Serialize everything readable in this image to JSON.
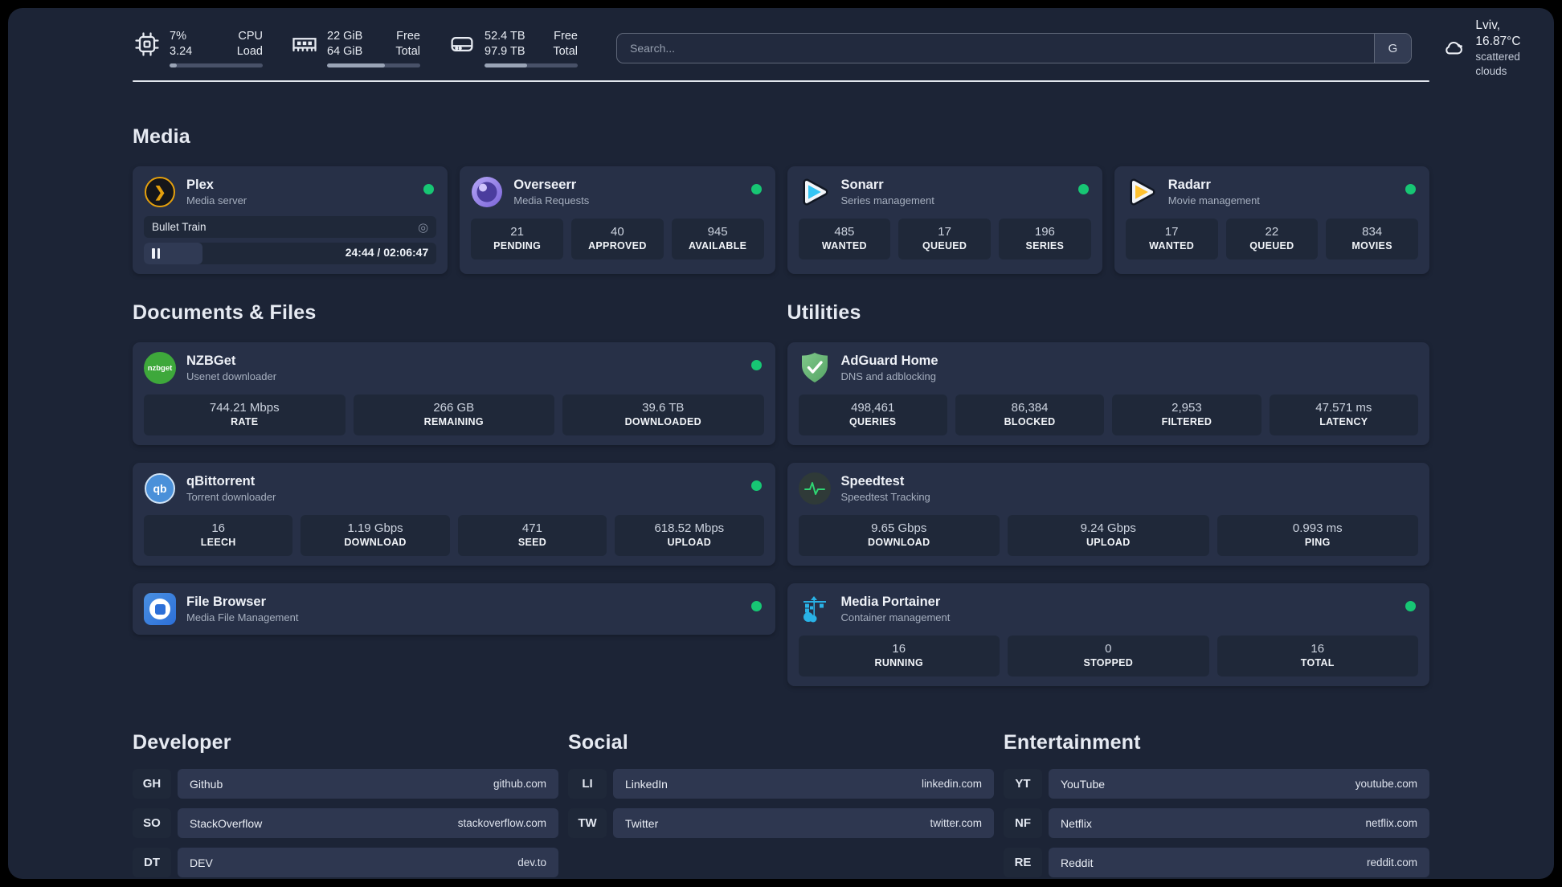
{
  "theme": {
    "panel_bg": "#1c2436",
    "card_bg": "#273047",
    "stat_bg": "#1f2839",
    "online_green": "#17c674",
    "plex_amber": "#e5a00d",
    "sonarr_blue": "#35c5f4",
    "radarr_amber": "#ffc230",
    "adguard_green": "#68bc71",
    "portainer_blue": "#29b2e6",
    "nzbget_green": "#3ea83b",
    "speedtest_green": "#2fd573"
  },
  "header": {
    "system_stats": [
      {
        "icon": "cpu-icon",
        "values": [
          "7%",
          "3.24"
        ],
        "labels": [
          "CPU",
          "Load"
        ],
        "progress": 8
      },
      {
        "icon": "ram-icon",
        "values": [
          "22 GiB",
          "64 GiB"
        ],
        "labels": [
          "Free",
          "Total"
        ],
        "progress": 62
      },
      {
        "icon": "disk-icon",
        "values": [
          "52.4 TB",
          "97.9 TB"
        ],
        "labels": [
          "Free",
          "Total"
        ],
        "progress": 46
      }
    ],
    "search": {
      "placeholder": "Search...",
      "engine_button": "G"
    },
    "weather": {
      "summary": "Lviv, 16.87°C",
      "condition": "scattered clouds"
    }
  },
  "media": {
    "title": "Media",
    "plex": {
      "name": "Plex",
      "desc": "Media server",
      "now_playing": "Bullet Train",
      "time": "24:44 / 02:06:47",
      "progress": 20
    },
    "overseerr": {
      "name": "Overseerr",
      "desc": "Media Requests",
      "stats": [
        {
          "value": "21",
          "label": "PENDING"
        },
        {
          "value": "40",
          "label": "APPROVED"
        },
        {
          "value": "945",
          "label": "AVAILABLE"
        }
      ]
    },
    "sonarr": {
      "name": "Sonarr",
      "desc": "Series management",
      "stats": [
        {
          "value": "485",
          "label": "WANTED"
        },
        {
          "value": "17",
          "label": "QUEUED"
        },
        {
          "value": "196",
          "label": "SERIES"
        }
      ]
    },
    "radarr": {
      "name": "Radarr",
      "desc": "Movie management",
      "stats": [
        {
          "value": "17",
          "label": "WANTED"
        },
        {
          "value": "22",
          "label": "QUEUED"
        },
        {
          "value": "834",
          "label": "MOVIES"
        }
      ]
    }
  },
  "documents": {
    "title": "Documents & Files",
    "nzbget": {
      "name": "NZBGet",
      "desc": "Usenet downloader",
      "icon_text": "nzbget",
      "stats": [
        {
          "value": "744.21 Mbps",
          "label": "RATE"
        },
        {
          "value": "266 GB",
          "label": "REMAINING"
        },
        {
          "value": "39.6 TB",
          "label": "DOWNLOADED"
        }
      ]
    },
    "qbittorrent": {
      "name": "qBittorrent",
      "desc": "Torrent downloader",
      "icon_text": "qb",
      "stats": [
        {
          "value": "16",
          "label": "LEECH"
        },
        {
          "value": "1.19 Gbps",
          "label": "DOWNLOAD"
        },
        {
          "value": "471",
          "label": "SEED"
        },
        {
          "value": "618.52 Mbps",
          "label": "UPLOAD"
        }
      ]
    },
    "filebrowser": {
      "name": "File Browser",
      "desc": "Media File Management"
    }
  },
  "utilities": {
    "title": "Utilities",
    "adguard": {
      "name": "AdGuard Home",
      "desc": "DNS and adblocking",
      "stats": [
        {
          "value": "498,461",
          "label": "QUERIES"
        },
        {
          "value": "86,384",
          "label": "BLOCKED"
        },
        {
          "value": "2,953",
          "label": "FILTERED"
        },
        {
          "value": "47.571 ms",
          "label": "LATENCY"
        }
      ]
    },
    "speedtest": {
      "name": "Speedtest",
      "desc": "Speedtest Tracking",
      "stats": [
        {
          "value": "9.65 Gbps",
          "label": "DOWNLOAD"
        },
        {
          "value": "9.24 Gbps",
          "label": "UPLOAD"
        },
        {
          "value": "0.993 ms",
          "label": "PING"
        }
      ]
    },
    "portainer": {
      "name": "Media Portainer",
      "desc": "Container management",
      "stats": [
        {
          "value": "16",
          "label": "RUNNING"
        },
        {
          "value": "0",
          "label": "STOPPED"
        },
        {
          "value": "16",
          "label": "TOTAL"
        }
      ]
    }
  },
  "links": {
    "developer": {
      "title": "Developer",
      "items": [
        {
          "abbr": "GH",
          "name": "Github",
          "url": "github.com"
        },
        {
          "abbr": "SO",
          "name": "StackOverflow",
          "url": "stackoverflow.com"
        },
        {
          "abbr": "DT",
          "name": "DEV",
          "url": "dev.to"
        }
      ]
    },
    "social": {
      "title": "Social",
      "items": [
        {
          "abbr": "LI",
          "name": "LinkedIn",
          "url": "linkedin.com"
        },
        {
          "abbr": "TW",
          "name": "Twitter",
          "url": "twitter.com"
        }
      ]
    },
    "entertainment": {
      "title": "Entertainment",
      "items": [
        {
          "abbr": "YT",
          "name": "YouTube",
          "url": "youtube.com"
        },
        {
          "abbr": "NF",
          "name": "Netflix",
          "url": "netflix.com"
        },
        {
          "abbr": "RE",
          "name": "Reddit",
          "url": "reddit.com"
        }
      ]
    }
  }
}
